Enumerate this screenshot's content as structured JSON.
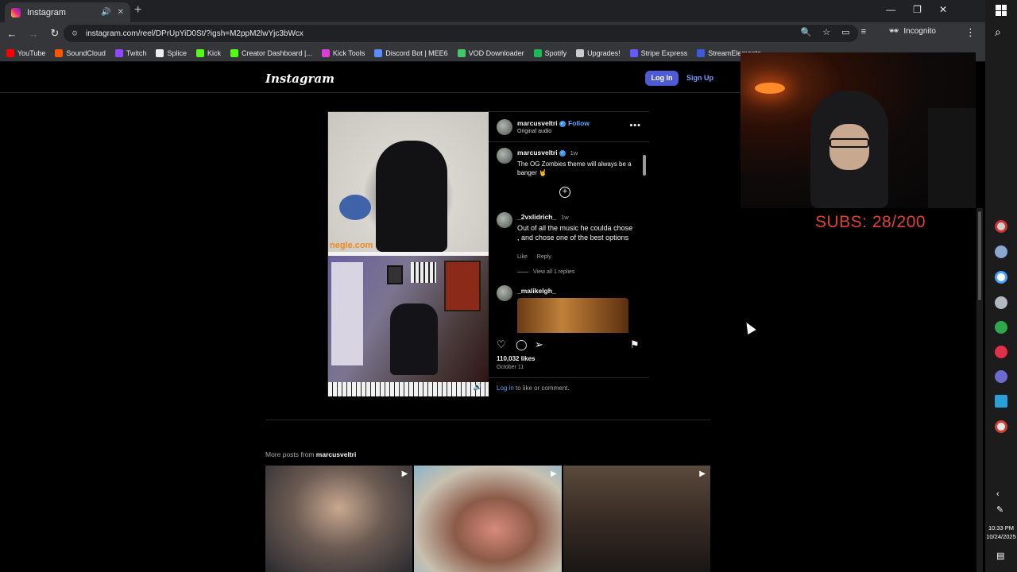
{
  "browser": {
    "tab_title": "Instagram",
    "url": "instagram.com/reel/DPrUpYiD0St/?igsh=M2ppM2lwYjc3bWcx",
    "incognito_label": "Incognito",
    "bookmarks": [
      {
        "label": "YouTube",
        "color": "#ff0000"
      },
      {
        "label": "SoundCloud",
        "color": "#ff5500"
      },
      {
        "label": "Twitch",
        "color": "#9146ff"
      },
      {
        "label": "Splice",
        "color": "#eeeeee"
      },
      {
        "label": "Kick",
        "color": "#53fc18"
      },
      {
        "label": "Creator Dashboard |...",
        "color": "#53fc18"
      },
      {
        "label": "Kick Tools",
        "color": "#e03dd8"
      },
      {
        "label": "Discord Bot | MEE6",
        "color": "#5b8cff"
      },
      {
        "label": "VOD Downloader",
        "color": "#44c767"
      },
      {
        "label": "Spotify",
        "color": "#1db954"
      },
      {
        "label": "Upgrades!",
        "color": "#cccccc"
      },
      {
        "label": "Stripe Express",
        "color": "#635bff"
      },
      {
        "label": "StreamElements",
        "color": "#3b5bdb"
      }
    ]
  },
  "instagram": {
    "logo": "Instagram",
    "login_button": "Log In",
    "signup_button": "Sign Up",
    "post": {
      "username": "marcusveltri",
      "follow_label": "Follow",
      "audio_label": "Original audio",
      "caption": {
        "username": "marcusveltri",
        "time": "1w",
        "text": "The OG Zombies theme will always be a banger 🤘"
      },
      "comments": [
        {
          "username": "_2vxlidrich_",
          "time": "1w",
          "text": "Out of all the music he coulda chose , and chose one of the best options",
          "like_label": "Like",
          "reply_label": "Reply",
          "view_replies": "View all 1 replies"
        },
        {
          "username": "_malikelgh_"
        }
      ],
      "video_watermark": "negle.com",
      "likes": "110,032 likes",
      "date": "October 11",
      "login_link": "Log in",
      "login_suffix": " to like or comment."
    },
    "more_posts_prefix": "More posts from ",
    "more_posts_user": "marcusveltri"
  },
  "stream_overlay": {
    "subs_text": "SUBS: 28/200"
  },
  "taskbar": {
    "time": "10:33 PM",
    "date": "10/24/2025"
  }
}
